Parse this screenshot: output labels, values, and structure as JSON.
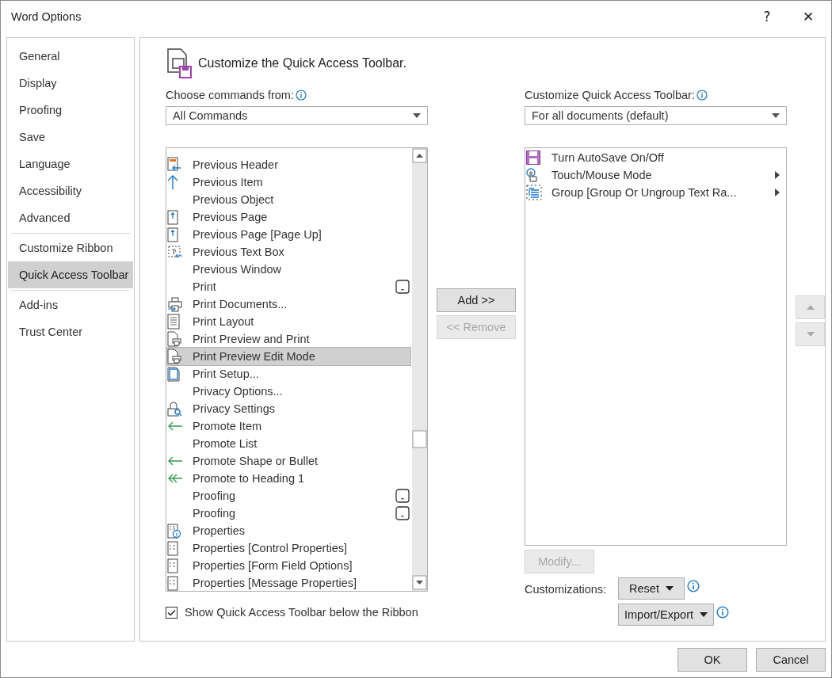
{
  "window": {
    "title": "Word Options",
    "help": "?",
    "close": "✕"
  },
  "sidebar": {
    "items": [
      {
        "label": "General",
        "selected": false,
        "group_start": false
      },
      {
        "label": "Display",
        "selected": false,
        "group_start": false
      },
      {
        "label": "Proofing",
        "selected": false,
        "group_start": false
      },
      {
        "label": "Save",
        "selected": false,
        "group_start": false
      },
      {
        "label": "Language",
        "selected": false,
        "group_start": false
      },
      {
        "label": "Accessibility",
        "selected": false,
        "group_start": false
      },
      {
        "label": "Advanced",
        "selected": false,
        "group_start": false
      },
      {
        "label": "Customize Ribbon",
        "selected": false,
        "group_start": true
      },
      {
        "label": "Quick Access Toolbar",
        "selected": true,
        "group_start": false
      },
      {
        "label": "Add-ins",
        "selected": false,
        "group_start": true
      },
      {
        "label": "Trust Center",
        "selected": false,
        "group_start": false
      }
    ]
  },
  "heading": "Customize the Quick Access Toolbar.",
  "commands": {
    "label": "Choose commands from:",
    "value": "All Commands",
    "items": [
      {
        "label": "Previous Header",
        "kind": "header",
        "dropdown": false,
        "selected": false
      },
      {
        "label": "Previous Item",
        "kind": "up-arrow",
        "dropdown": false,
        "selected": false
      },
      {
        "label": "Previous Object",
        "kind": "none",
        "dropdown": false,
        "selected": false
      },
      {
        "label": "Previous Page",
        "kind": "page-up",
        "dropdown": false,
        "selected": false
      },
      {
        "label": "Previous Page [Page Up]",
        "kind": "page-up",
        "dropdown": false,
        "selected": false
      },
      {
        "label": "Previous Text Box",
        "kind": "textbox",
        "dropdown": false,
        "selected": false
      },
      {
        "label": "Previous Window",
        "kind": "none",
        "dropdown": false,
        "selected": false
      },
      {
        "label": "Print",
        "kind": "none",
        "dropdown": true,
        "selected": false
      },
      {
        "label": "Print Documents...",
        "kind": "printer",
        "dropdown": false,
        "selected": false
      },
      {
        "label": "Print Layout",
        "kind": "layout",
        "dropdown": false,
        "selected": false
      },
      {
        "label": "Print Preview and Print",
        "kind": "preview",
        "dropdown": false,
        "selected": false
      },
      {
        "label": "Print Preview Edit Mode",
        "kind": "preview",
        "dropdown": false,
        "selected": true
      },
      {
        "label": "Print Setup...",
        "kind": "setup",
        "dropdown": false,
        "selected": false
      },
      {
        "label": "Privacy Options...",
        "kind": "none",
        "dropdown": false,
        "selected": false
      },
      {
        "label": "Privacy Settings",
        "kind": "lock",
        "dropdown": false,
        "selected": false
      },
      {
        "label": "Promote Item",
        "kind": "left-arrow",
        "dropdown": false,
        "selected": false
      },
      {
        "label": "Promote List",
        "kind": "none",
        "dropdown": false,
        "selected": false
      },
      {
        "label": "Promote Shape or Bullet",
        "kind": "left-arrow",
        "dropdown": false,
        "selected": false
      },
      {
        "label": "Promote to Heading 1",
        "kind": "double-left",
        "dropdown": false,
        "selected": false
      },
      {
        "label": "Proofing",
        "kind": "none",
        "dropdown": true,
        "selected": false
      },
      {
        "label": "Proofing",
        "kind": "none",
        "dropdown": true,
        "selected": false
      },
      {
        "label": "Properties",
        "kind": "properties-info",
        "dropdown": false,
        "selected": false
      },
      {
        "label": "Properties [Control Properties]",
        "kind": "properties",
        "dropdown": false,
        "selected": false
      },
      {
        "label": "Properties [Form Field Options]",
        "kind": "properties",
        "dropdown": false,
        "selected": false
      },
      {
        "label": "Properties [Message Properties]",
        "kind": "properties",
        "dropdown": false,
        "selected": false
      }
    ]
  },
  "toolbar": {
    "label": "Customize Quick Access Toolbar:",
    "value": "For all documents (default)",
    "items": [
      {
        "label": "Turn AutoSave On/Off",
        "kind": "save",
        "submenu": false
      },
      {
        "label": "Touch/Mouse Mode",
        "kind": "touch",
        "submenu": true
      },
      {
        "label": "Group [Group Or Ungroup Text Ra...",
        "kind": "group",
        "submenu": true
      }
    ]
  },
  "add_button": {
    "label": "Add >>",
    "disabled": false
  },
  "remove_button": {
    "label": "<< Remove",
    "disabled": true
  },
  "modify_button": {
    "label": "Modify...",
    "disabled": true
  },
  "customizations_label": "Customizations:",
  "reset_button": "Reset",
  "import_export_button": "Import/Export",
  "show_below_ribbon": {
    "label": "Show Quick Access Toolbar below the Ribbon",
    "checked": true
  },
  "buttons": [
    "OK",
    "Cancel"
  ]
}
